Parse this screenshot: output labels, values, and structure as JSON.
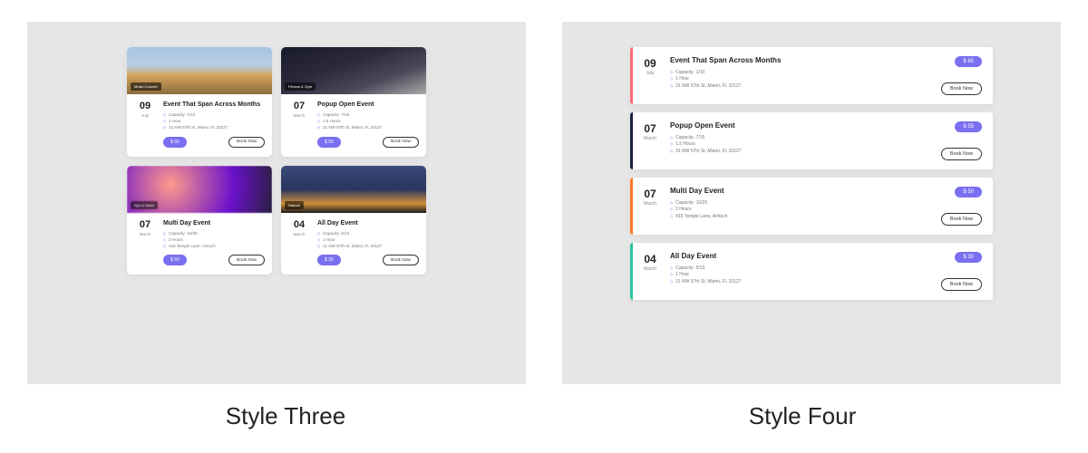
{
  "labels": {
    "left": "Style Three",
    "right": "Style Four"
  },
  "events": [
    {
      "day": "09",
      "month": "July",
      "title": "Event That Span Across Months",
      "tag": "Music Concert",
      "capacity": "Capacity- 1/10",
      "duration": "1 Hour",
      "location": "31 NW 57th St, Miami, FL 33127",
      "price": "$ 65",
      "book": "Book Now",
      "imgClass": "img-a",
      "barClass": "c-a"
    },
    {
      "day": "07",
      "month": "March",
      "title": "Popup Open Event",
      "tag": "Fitness & Gym",
      "capacity": "Capacity- 7/15",
      "duration": "1.5 Hours",
      "location": "31 NW 57th St, Miami, FL 33127",
      "price": "$ 55",
      "book": "Book Now",
      "imgClass": "img-b",
      "barClass": "c-b"
    },
    {
      "day": "07",
      "month": "March",
      "title": "Multi Day Event",
      "tag": "Spa & Salon",
      "capacity": "Capacity- 10/25",
      "duration": "2 Hours",
      "location": "415 Temple Lane, Antioch",
      "price": "$ 50",
      "book": "Book Now",
      "imgClass": "img-c",
      "barClass": "c-c"
    },
    {
      "day": "04",
      "month": "March",
      "title": "All Day Event",
      "tag": "Haircut",
      "capacity": "Capacity- 5/13",
      "duration": "1 Hour",
      "location": "31 NW 57th St, Miami, FL 33127",
      "price": "$ 30",
      "book": "Book Now",
      "imgClass": "img-d",
      "barClass": "c-d"
    }
  ]
}
